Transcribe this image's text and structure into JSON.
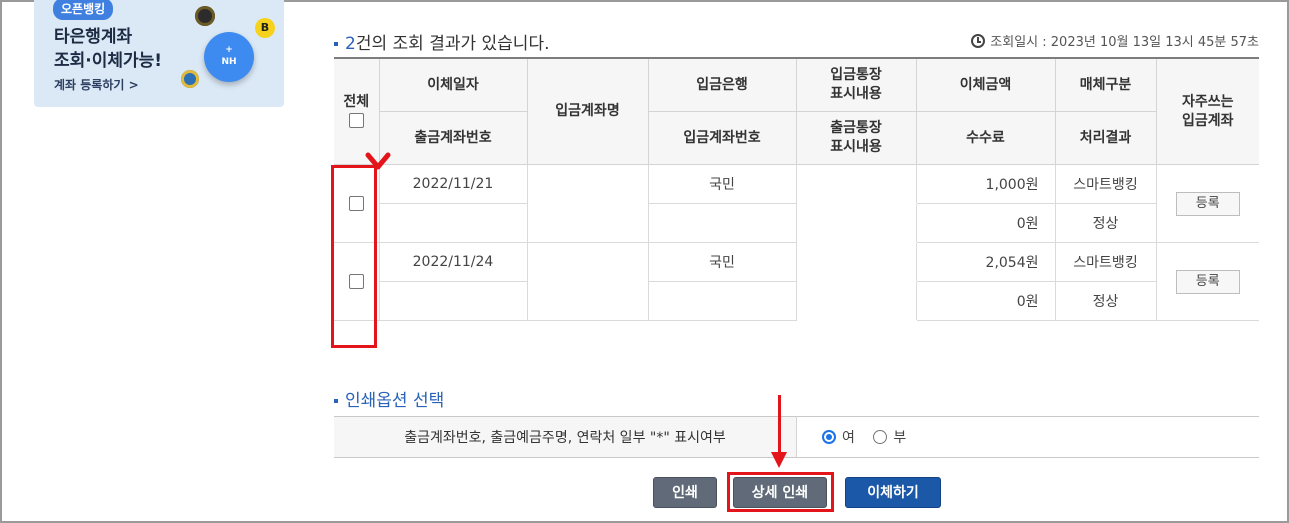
{
  "banner": {
    "badge": "오픈뱅킹",
    "line1": "타은행계좌",
    "line2": "조회·이체가능!",
    "link": "계좌 등록하기 >",
    "nh_label": "NH",
    "coin_b": "B"
  },
  "result": {
    "count": "2",
    "text": "건의 조회 결과가 있습니다.",
    "inquiry_time": "조회일시 : 2023년 10월 13일 13시 45분 57초"
  },
  "table": {
    "headers": {
      "all": "전체",
      "transfer_date": "이체일자",
      "withdraw_account": "출금계좌번호",
      "deposit_name": "입금계좌명",
      "deposit_bank": "입금은행",
      "deposit_account": "입금계좌번호",
      "deposit_memo": "입금통장\n표시내용",
      "withdraw_memo": "출금통장\n표시내용",
      "amount": "이체금액",
      "fee": "수수료",
      "medium": "매체구분",
      "process_result": "처리결과",
      "favorite": "자주쓰는\n입금계좌"
    },
    "rows": [
      {
        "date": "2022/11/21",
        "bank": "국민",
        "amount": "1,000원",
        "fee": "0원",
        "medium": "스마트뱅킹",
        "result": "정상",
        "register": "등록"
      },
      {
        "date": "2022/11/24",
        "bank": "국민",
        "amount": "2,054원",
        "fee": "0원",
        "medium": "스마트뱅킹",
        "result": "정상",
        "register": "등록"
      }
    ]
  },
  "print_options": {
    "title": "인쇄옵션 선택",
    "label": "출금계좌번호, 출금예금주명, 연락처 일부 \"*\" 표시여부",
    "yes": "여",
    "no": "부",
    "selected": "여"
  },
  "buttons": {
    "print": "인쇄",
    "detail_print": "상세 인쇄",
    "transfer": "이체하기"
  },
  "colors": {
    "accent": "#2a62b8",
    "highlight": "#e4141b",
    "primary_button": "#1c58a8",
    "secondary_button": "#606a78"
  }
}
